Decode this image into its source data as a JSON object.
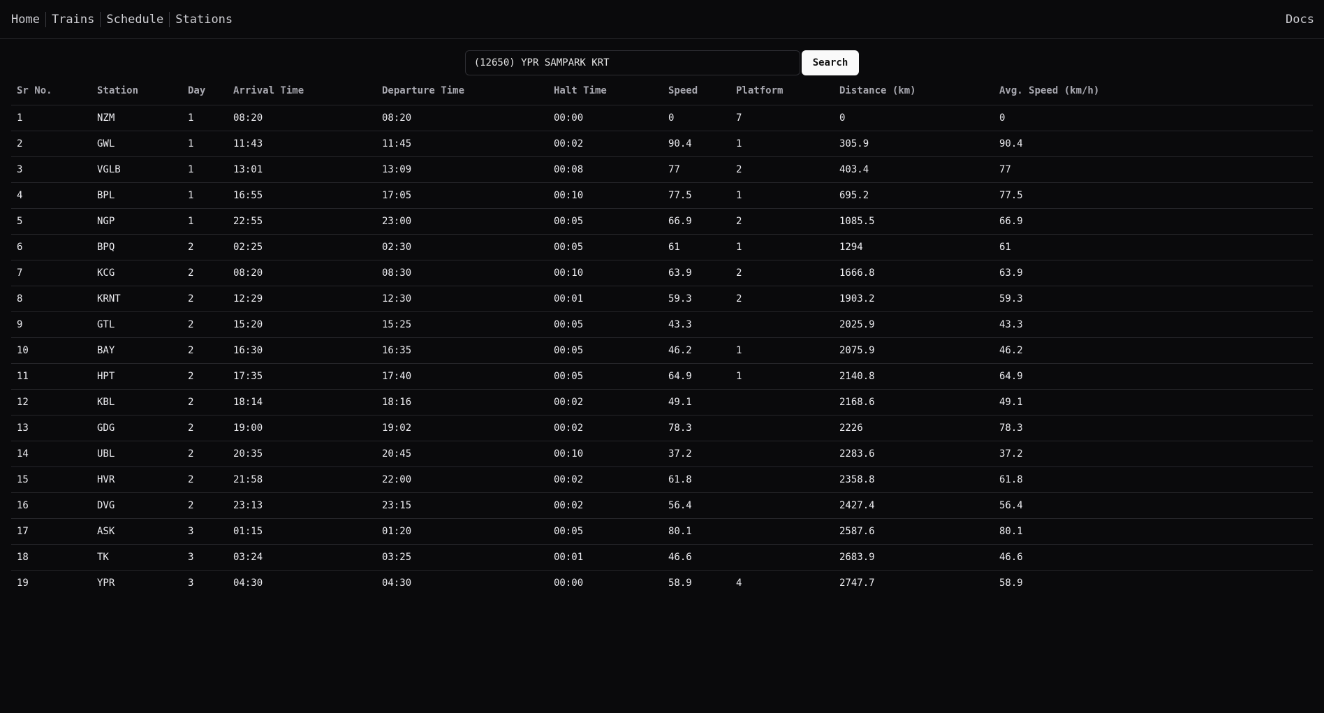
{
  "nav": {
    "items": [
      "Home",
      "Trains",
      "Schedule",
      "Stations"
    ],
    "docs": "Docs"
  },
  "search": {
    "value": "(12650) YPR SAMPARK KRT",
    "button": "Search"
  },
  "table": {
    "headers": [
      "Sr No.",
      "Station",
      "Day",
      "Arrival Time",
      "Departure Time",
      "Halt Time",
      "Speed",
      "Platform",
      "Distance (km)",
      "Avg. Speed (km/h)"
    ],
    "rows": [
      [
        "1",
        "NZM",
        "1",
        "08:20",
        "08:20",
        "00:00",
        "0",
        "7",
        "0",
        "0"
      ],
      [
        "2",
        "GWL",
        "1",
        "11:43",
        "11:45",
        "00:02",
        "90.4",
        "1",
        "305.9",
        "90.4"
      ],
      [
        "3",
        "VGLB",
        "1",
        "13:01",
        "13:09",
        "00:08",
        "77",
        "2",
        "403.4",
        "77"
      ],
      [
        "4",
        "BPL",
        "1",
        "16:55",
        "17:05",
        "00:10",
        "77.5",
        "1",
        "695.2",
        "77.5"
      ],
      [
        "5",
        "NGP",
        "1",
        "22:55",
        "23:00",
        "00:05",
        "66.9",
        "2",
        "1085.5",
        "66.9"
      ],
      [
        "6",
        "BPQ",
        "2",
        "02:25",
        "02:30",
        "00:05",
        "61",
        "1",
        "1294",
        "61"
      ],
      [
        "7",
        "KCG",
        "2",
        "08:20",
        "08:30",
        "00:10",
        "63.9",
        "2",
        "1666.8",
        "63.9"
      ],
      [
        "8",
        "KRNT",
        "2",
        "12:29",
        "12:30",
        "00:01",
        "59.3",
        "2",
        "1903.2",
        "59.3"
      ],
      [
        "9",
        "GTL",
        "2",
        "15:20",
        "15:25",
        "00:05",
        "43.3",
        "",
        "2025.9",
        "43.3"
      ],
      [
        "10",
        "BAY",
        "2",
        "16:30",
        "16:35",
        "00:05",
        "46.2",
        "1",
        "2075.9",
        "46.2"
      ],
      [
        "11",
        "HPT",
        "2",
        "17:35",
        "17:40",
        "00:05",
        "64.9",
        "1",
        "2140.8",
        "64.9"
      ],
      [
        "12",
        "KBL",
        "2",
        "18:14",
        "18:16",
        "00:02",
        "49.1",
        "",
        "2168.6",
        "49.1"
      ],
      [
        "13",
        "GDG",
        "2",
        "19:00",
        "19:02",
        "00:02",
        "78.3",
        "",
        "2226",
        "78.3"
      ],
      [
        "14",
        "UBL",
        "2",
        "20:35",
        "20:45",
        "00:10",
        "37.2",
        "",
        "2283.6",
        "37.2"
      ],
      [
        "15",
        "HVR",
        "2",
        "21:58",
        "22:00",
        "00:02",
        "61.8",
        "",
        "2358.8",
        "61.8"
      ],
      [
        "16",
        "DVG",
        "2",
        "23:13",
        "23:15",
        "00:02",
        "56.4",
        "",
        "2427.4",
        "56.4"
      ],
      [
        "17",
        "ASK",
        "3",
        "01:15",
        "01:20",
        "00:05",
        "80.1",
        "",
        "2587.6",
        "80.1"
      ],
      [
        "18",
        "TK",
        "3",
        "03:24",
        "03:25",
        "00:01",
        "46.6",
        "",
        "2683.9",
        "46.6"
      ],
      [
        "19",
        "YPR",
        "3",
        "04:30",
        "04:30",
        "00:00",
        "58.9",
        "4",
        "2747.7",
        "58.9"
      ]
    ]
  }
}
